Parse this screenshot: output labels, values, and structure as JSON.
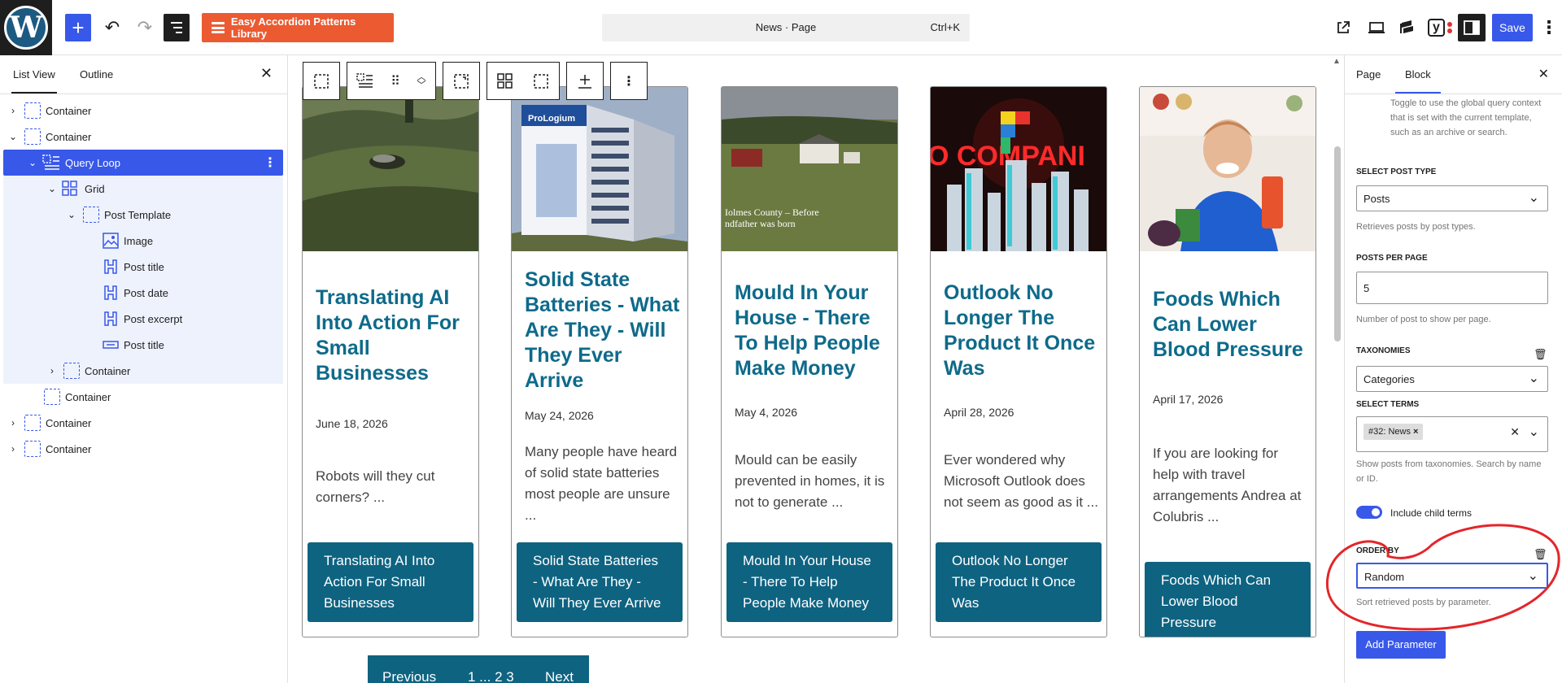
{
  "topbar": {
    "logo_letter": "W",
    "accordion_label": "Easy Accordion Patterns Library",
    "command_title": "News · Page",
    "command_shortcut": "Ctrl+K",
    "yoast_label": "y",
    "save_label": "Save"
  },
  "left_panel": {
    "tabs": [
      "List View",
      "Outline"
    ],
    "tree": [
      {
        "label": "Container"
      },
      {
        "label": "Container"
      },
      {
        "label": "Query Loop"
      },
      {
        "label": "Grid"
      },
      {
        "label": "Post Template"
      },
      {
        "label": "Image"
      },
      {
        "label": "Post title"
      },
      {
        "label": "Post date"
      },
      {
        "label": "Post excerpt"
      },
      {
        "label": "Post title"
      },
      {
        "label": "Container"
      },
      {
        "label": "Container"
      },
      {
        "label": "Container"
      },
      {
        "label": "Container"
      }
    ]
  },
  "posts": [
    {
      "title": "Translating AI Into Action For Small Businesses",
      "date": "June 18, 2026",
      "excerpt": "Robots will they cut corners? ...",
      "button": "Translating AI Into Action For Small Businesses"
    },
    {
      "title": "Solid State Batteries - What Are They - Will They Ever Arrive",
      "date": "May 24, 2026",
      "excerpt": "Many people have heard of solid state batteries most people are unsure ...",
      "button": "Solid State Batteries - What Are They - Will They Ever Arrive",
      "image_text": "ProLogium"
    },
    {
      "title": "Mould In Your House - There To Help People Make Money",
      "date": "May 4, 2026",
      "excerpt": "Mould can be easily prevented in homes, it is not to generate ...",
      "button": "Mould In Your House - There To Help People Make Money",
      "image_text": "Iolmes County – Before\nndfather was born"
    },
    {
      "title": "Outlook No Longer The Product It Once Was",
      "date": "April 28, 2026",
      "excerpt": "Ever wondered why Microsoft Outlook does not seem as good as it ...",
      "button": "Outlook No Longer The Product It Once Was",
      "image_text": "O COMPANI"
    },
    {
      "title": "Foods Which Can Lower Blood Pressure",
      "date": "April 17, 2026",
      "excerpt": "If you are looking for help with travel arrangements Andrea at Colubris ...",
      "button": "Foods Which Can Lower Blood Pressure"
    }
  ],
  "pagination": {
    "previous": "Previous",
    "pages": "1 ... 2 3",
    "next": "Next"
  },
  "right_panel": {
    "tabs": [
      "Page",
      "Block"
    ],
    "inherit_help": "Toggle to use the global query context that is set with the current template, such as an archive or search.",
    "post_type_label": "SELECT POST TYPE",
    "post_type_value": "Posts",
    "post_type_help": "Retrieves posts by post types.",
    "per_page_label": "POSTS PER PAGE",
    "per_page_value": "5",
    "per_page_help": "Number of post to show per page.",
    "taxonomies_label": "TAXONOMIES",
    "taxonomies_value": "Categories",
    "terms_label": "SELECT TERMS",
    "terms_token": "#32: News",
    "terms_help": "Show posts from taxonomies. Search by name or ID.",
    "include_children": "Include child terms",
    "include_children_on": true,
    "order_by_label": "ORDER BY",
    "order_by_value": "Random",
    "order_by_help": "Sort retrieved posts by parameter.",
    "add_parameter": "Add Parameter"
  },
  "colors": {
    "accent": "#3858e9",
    "title_blue": "#0e6a8a",
    "button_teal": "#0e6381",
    "accordion_orange": "#ec5a31",
    "annotation_red": "#e3262a"
  }
}
